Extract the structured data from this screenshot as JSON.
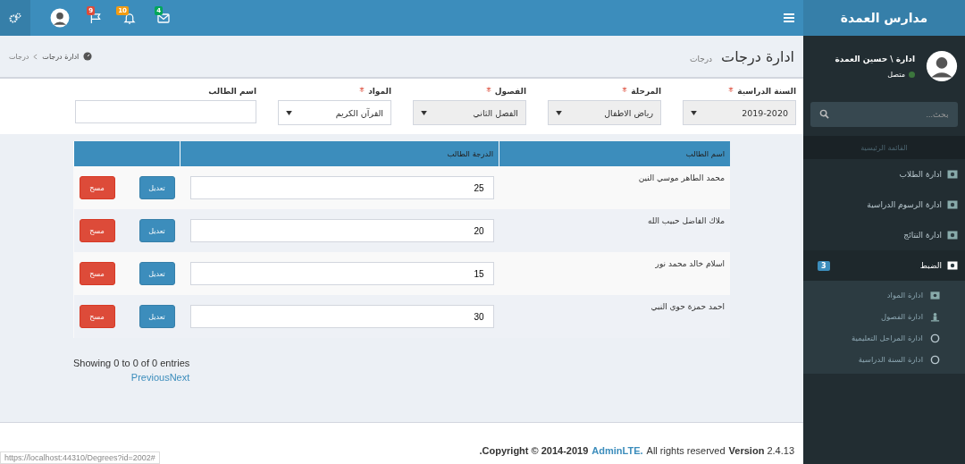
{
  "sidebar": {
    "brand": "مدارس العمدة",
    "user": {
      "name": "ادارة \\ حسين العمدة",
      "status": "متصل",
      "online": true
    },
    "search": {
      "placeholder": "بحث..."
    },
    "menu_header": "القائمة الرئيسية",
    "items": [
      {
        "label": "ادارة الطلاب",
        "expanded": false
      },
      {
        "label": "ادارة الرسوم الدراسية",
        "expanded": false
      },
      {
        "label": "ادارة النتائج",
        "expanded": false
      },
      {
        "label": "الضبط",
        "expanded": true,
        "badge": "3",
        "children": [
          {
            "label": "ادارة المواد",
            "kind": "picture"
          },
          {
            "label": "ادارة الفصول",
            "kind": "person"
          },
          {
            "label": "ادارة المراحل التعليمية",
            "kind": "circle"
          },
          {
            "label": "ادارة السنة الدراسية",
            "kind": "circle"
          }
        ]
      }
    ]
  },
  "header": {
    "badges": [
      {
        "kind": "mail",
        "count": "4",
        "color": "#00a65a"
      },
      {
        "kind": "bell",
        "count": "10",
        "color": "#f39c12"
      },
      {
        "kind": "flag",
        "count": "9",
        "color": "#dd4b39"
      }
    ]
  },
  "content_header": {
    "title": "ادارة درجات",
    "subtitle": "درجات",
    "breadcrumb": [
      "ادارة درجات",
      "درجات"
    ]
  },
  "filters": [
    {
      "label": "السنة الدراسية",
      "required": true,
      "value": "2019-2020",
      "disabled": true
    },
    {
      "label": "المرحلة",
      "required": true,
      "value": "رياض الاطفال",
      "disabled": true
    },
    {
      "label": "الفصول",
      "required": true,
      "value": "الفصل الثاني",
      "disabled": true
    },
    {
      "label": "المواد",
      "required": true,
      "value": "القرآن الكريم",
      "disabled": false
    }
  ],
  "student_filter": {
    "label": "اسم الطالب"
  },
  "table": {
    "columns": [
      "اسم الطالب",
      "الدرجة الطالب"
    ],
    "rows": [
      {
        "name": "محمد الطاهر موسي النين",
        "grade": "25",
        "edit": "تعديل",
        "delete": "مسح"
      },
      {
        "name": "ملاك الفاضل حبيب الله",
        "grade": "20",
        "edit": "تعديل",
        "delete": "مسح"
      },
      {
        "name": "اسلام خالد محمد نور",
        "grade": "15",
        "edit": "تعديل",
        "delete": "مسح"
      },
      {
        "name": "احمد حمزة حوي النبي",
        "grade": "30",
        "edit": "تعديل",
        "delete": "مسح"
      }
    ]
  },
  "pagination": {
    "info": "Showing 0 to 0 of 0 entries",
    "previous": "Previous",
    "next": "Next"
  },
  "footer": {
    "copyright": ".Copyright © 2014-2019",
    "link": "AdminLTE.",
    "rights": "All rights reserved",
    "version": "**Version** 2.4.13"
  },
  "status_bar": {
    "url": "https://localhost:44310/Degrees?id=2002#"
  }
}
